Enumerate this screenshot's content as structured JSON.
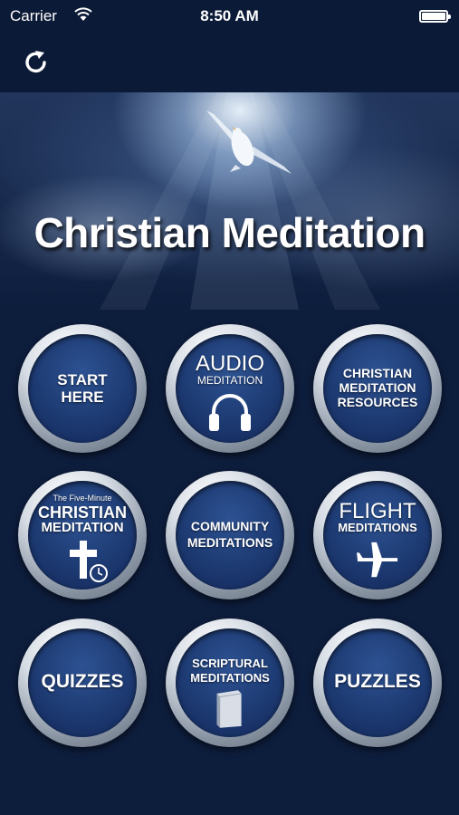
{
  "status_bar": {
    "carrier": "Carrier",
    "time": "8:50 AM"
  },
  "banner": {
    "title": "Christian Meditation"
  },
  "tiles": [
    {
      "lines": [
        "START",
        "HERE"
      ]
    },
    {
      "big": "AUDIO",
      "small": "MEDITATION",
      "icon": "headphones-icon"
    },
    {
      "lines": [
        "CHRISTIAN",
        "MEDITATION",
        "RESOURCES"
      ]
    },
    {
      "tiny": "The Five-Minute",
      "lines": [
        "CHRISTIAN",
        "MEDITATION"
      ],
      "icon": "cross-clock-icon"
    },
    {
      "lines": [
        "COMMUNITY",
        "MEDITATIONS"
      ]
    },
    {
      "big": "FLIGHT",
      "small": "MEDITATIONS",
      "icon": "airplane-icon"
    },
    {
      "lines": [
        "QUIZZES"
      ]
    },
    {
      "lines": [
        "SCRIPTURAL",
        "MEDITATIONS"
      ],
      "icon": "book-icon"
    },
    {
      "lines": [
        "PUZZLES"
      ]
    }
  ],
  "colors": {
    "background": "#0d1d3c",
    "tile_face": "#1d3a72",
    "tile_ring": "#c8cfd8"
  }
}
